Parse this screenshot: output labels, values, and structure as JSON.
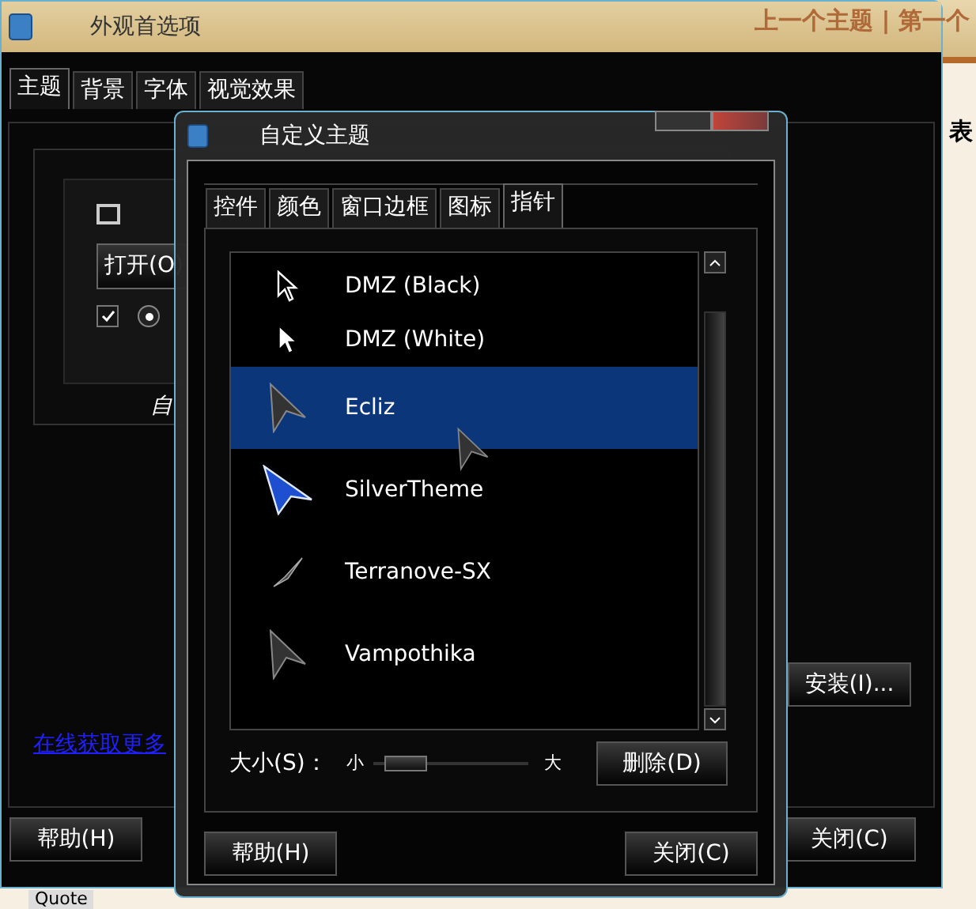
{
  "browser": {
    "nav_links": "上一个主题 | 第一个",
    "side_text": "表",
    "bottom_text": "Quote"
  },
  "back_window": {
    "title": "外观首选项",
    "tabs": [
      {
        "label": "主题",
        "selected": true
      },
      {
        "label": "背景",
        "selected": false
      },
      {
        "label": "字体",
        "selected": false
      },
      {
        "label": "视觉效果",
        "selected": false
      }
    ],
    "preview": {
      "open_button": "打开(O)",
      "checked": true,
      "radio_selected": true,
      "caption": "自"
    },
    "install_button": "安装(I)...",
    "link": "在线获取更多",
    "help_button": "帮助(H)",
    "close_button": "关闭(C)"
  },
  "front_window": {
    "title": "自定义主题",
    "tabs": [
      {
        "label": "控件",
        "selected": false
      },
      {
        "label": "颜色",
        "selected": false
      },
      {
        "label": "窗口边框",
        "selected": false
      },
      {
        "label": "图标",
        "selected": false
      },
      {
        "label": "指针",
        "selected": true
      }
    ],
    "cursors": [
      {
        "name": "DMZ (Black)",
        "kind": "outline",
        "selected": false
      },
      {
        "name": "DMZ (White)",
        "kind": "solid",
        "selected": false
      },
      {
        "name": "Ecliz",
        "kind": "dark",
        "selected": true
      },
      {
        "name": "SilverTheme",
        "kind": "blue",
        "selected": false
      },
      {
        "name": "Terranove-SX",
        "kind": "thin",
        "selected": false
      },
      {
        "name": "Vampothika",
        "kind": "dark",
        "selected": false
      }
    ],
    "size": {
      "label": "大小(S)：",
      "min": "小",
      "max": "大",
      "level": 0.1
    },
    "delete_button": "删除(D)",
    "help_button": "帮助(H)",
    "close_button": "关闭(C)"
  }
}
